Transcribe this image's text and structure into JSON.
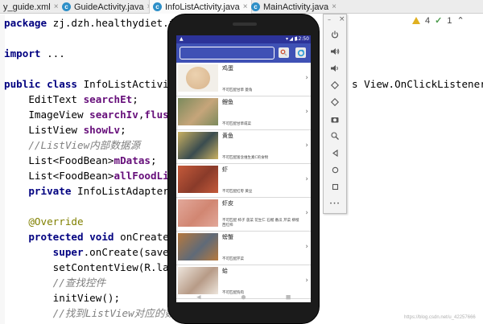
{
  "tabs": [
    {
      "label": "y_guide.xml",
      "icon": "xml-file-icon",
      "active": false
    },
    {
      "label": "GuideActivity.java",
      "icon": "c",
      "active": false
    },
    {
      "label": "InfoListActivity.java",
      "icon": "c",
      "active": true
    },
    {
      "label": "MainActivity.java",
      "icon": "c",
      "active": false
    }
  ],
  "tab_close_glyph": "×",
  "inspection": {
    "warnings": "4",
    "ok": "1"
  },
  "code_lines": [
    "package zj.dzh.healthydiet.food_",
    "",
    "import ...",
    "",
    "public class InfoListActivity e",
    "    EditText searchEt;",
    "    ImageView searchIv,flushIv;",
    "    ListView showLv;",
    "    //ListView内部数据源",
    "    List<FoodBean>mDatas;",
    "    List<FoodBean>allFoodList;",
    "    private InfoListAdapter ada",
    "",
    "    @Override",
    "    protected void onCreate(Bun",
    "        super.onCreate(savedIns",
    "        setContentView(R.layout",
    "        //查找控件",
    "        initView();",
    "        //找到ListView对应的数据源"
  ],
  "code_right_fragment": "s View.OnClickListener{",
  "emulator_toolbar": {
    "minimize": "–",
    "close": "×",
    "buttons": [
      "power-icon",
      "volume-up-icon",
      "volume-down-icon",
      "rotate-left-icon",
      "rotate-right-icon",
      "camera-icon",
      "zoom-icon",
      "back-icon",
      "home-icon",
      "overview-icon",
      "more-icon"
    ],
    "more_label": "•••"
  },
  "phone": {
    "status_time": "12:50",
    "search_placeholder": "",
    "foods": [
      {
        "name": "鸡蛋",
        "desc": "不可匹配甘草 菱角",
        "color1": "#d8b48c",
        "color2": "#f2efe9"
      },
      {
        "name": "鲤鱼",
        "desc": "不可匹配甘草咸菜",
        "color1": "#7b8a5c",
        "color2": "#c6a57a"
      },
      {
        "name": "黄鱼",
        "desc": "不可匹配富含维生素C的食物",
        "color1": "#c9b061",
        "color2": "#3a4c4f"
      },
      {
        "name": "虾",
        "desc": "不可匹配红枣 黄豆",
        "color1": "#c45a3a",
        "color2": "#8a3b2a"
      },
      {
        "name": "虾皮",
        "desc": "不可匹配 柿子 菠菜 花生仁 石榴 番瓜 芹菜 柳橙 西红柿",
        "color1": "#e2a89a",
        "color2": "#d18672"
      },
      {
        "name": "螃蟹",
        "desc": "不可匹配芹菜",
        "color1": "#b6793e",
        "color2": "#5f6a78"
      },
      {
        "name": "蛤",
        "desc": "不可匹配狗肉",
        "color1": "#ede5dc",
        "color2": "#b79b87"
      }
    ],
    "arrow_glyph": "›",
    "nav": {
      "back": "◀",
      "home": "●",
      "recent": "■"
    }
  },
  "watermark": "https://blog.csdn.net/u_42257666",
  "colors": {
    "appbar": "#3f51b5",
    "statusbar": "#2c3399",
    "keyword": "#000080",
    "field": "#660e7a",
    "comment": "#808080"
  }
}
